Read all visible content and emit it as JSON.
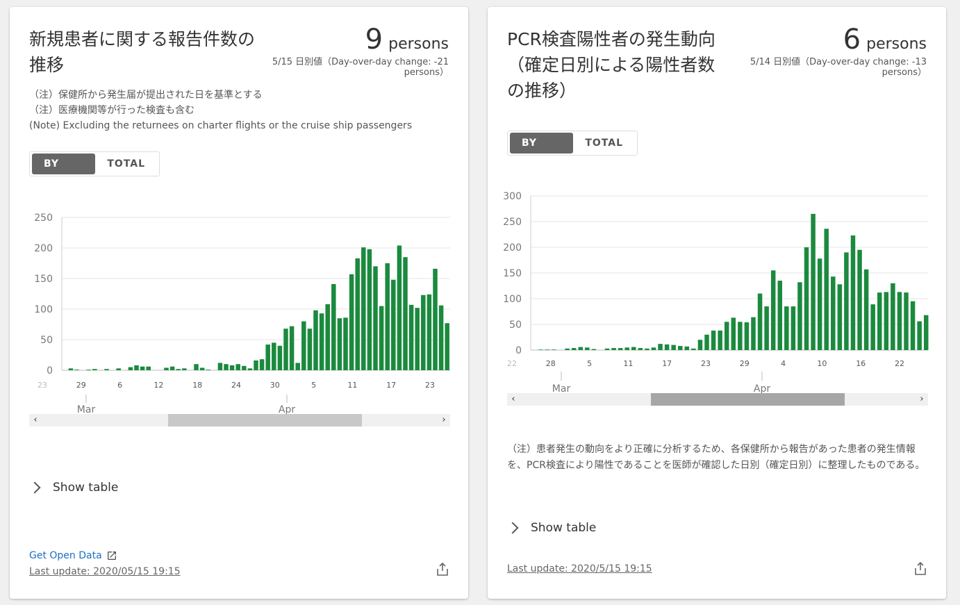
{
  "left_card": {
    "title": "新規患者に関する報告件数の推移",
    "value": "9",
    "unit": "persons",
    "subtext": "5/15 日別値（Day-over-day change: -21 persons）",
    "notes": [
      "（注）保健所から発生届が提出された日を基準とする",
      "（注）医療機関等が行った検査も含む",
      "(Note) Excluding the returnees on charter flights or the cruise ship passengers"
    ],
    "toggle": {
      "by_day": "BY DAY",
      "total": "TOTAL"
    },
    "show_table": "Show table",
    "open_data": "Get Open Data",
    "last_update": "Last update: 2020/05/15 19:15"
  },
  "right_card": {
    "title": "PCR検査陽性者の発生動向（確定日別による陽性者数の推移）",
    "value": "6",
    "unit": "persons",
    "subtext": "5/14 日別値（Day-over-day change: -13 persons）",
    "toggle": {
      "by_day": "BY DAY",
      "total": "TOTAL"
    },
    "description": "（注）患者発生の動向をより正確に分析するため、各保健所から報告があった患者の発生情報を、PCR検査により陽性であることを医師が確認した日別（確定日別）に整理したものである。",
    "show_table": "Show table",
    "last_update": "Last update: 2020/5/15 19:15"
  },
  "colors": {
    "bar": "#1b8a3e",
    "active_toggle": "#666666",
    "link": "#1a6fc4"
  },
  "chart_data": [
    {
      "type": "bar",
      "title": "新規患者に関する報告件数の推移",
      "bar_color": "#1b8a3e",
      "ylim": [
        0,
        250
      ],
      "yticks": [
        0,
        50,
        100,
        150,
        200,
        250
      ],
      "grid": true,
      "x_tick_labels": [
        "23",
        "29",
        "6",
        "12",
        "18",
        "24",
        "30",
        "5",
        "11",
        "17",
        "23"
      ],
      "month_labels": [
        "Mar",
        "Apr"
      ],
      "x": [
        "2/23",
        "2/24",
        "2/25",
        "2/26",
        "2/27",
        "2/28",
        "2/29",
        "3/1",
        "3/2",
        "3/3",
        "3/4",
        "3/5",
        "3/6",
        "3/7",
        "3/8",
        "3/9",
        "3/10",
        "3/11",
        "3/12",
        "3/13",
        "3/14",
        "3/15",
        "3/16",
        "3/17",
        "3/18",
        "3/19",
        "3/20",
        "3/21",
        "3/22",
        "3/23",
        "3/24",
        "3/25",
        "3/26",
        "3/27",
        "3/28",
        "3/29",
        "3/30",
        "3/31",
        "4/1",
        "4/2",
        "4/3",
        "4/4",
        "4/5",
        "4/6",
        "4/7",
        "4/8",
        "4/9",
        "4/10",
        "4/11",
        "4/12",
        "4/13",
        "4/14",
        "4/15",
        "4/16",
        "4/17",
        "4/18",
        "4/19",
        "4/20",
        "4/21",
        "4/22",
        "4/23",
        "4/24",
        "4/25",
        "4/26"
      ],
      "values": [
        0,
        3,
        1,
        0,
        1,
        2,
        0,
        2,
        0,
        3,
        0,
        5,
        8,
        6,
        6,
        0,
        0,
        4,
        6,
        2,
        3,
        0,
        10,
        4,
        1,
        0,
        12,
        10,
        8,
        10,
        7,
        3,
        16,
        18,
        42,
        45,
        40,
        68,
        72,
        12,
        80,
        68,
        98,
        93,
        108,
        141,
        85,
        86,
        157,
        183,
        201,
        198,
        170,
        105,
        175,
        148,
        204,
        185,
        107,
        102,
        123,
        124,
        166,
        106,
        77
      ]
    },
    {
      "type": "bar",
      "title": "PCR検査陽性者の発生動向（確定日別による陽性者数の推移）",
      "bar_color": "#1b8a3e",
      "ylim": [
        0,
        300
      ],
      "yticks": [
        0,
        50,
        100,
        150,
        200,
        250,
        300
      ],
      "grid": true,
      "x_tick_labels": [
        "22",
        "28",
        "5",
        "11",
        "17",
        "23",
        "29",
        "4",
        "10",
        "16",
        "22"
      ],
      "month_labels": [
        "Mar",
        "Apr"
      ],
      "values": [
        0,
        1,
        1,
        1,
        0,
        3,
        4,
        6,
        5,
        2,
        0,
        3,
        4,
        4,
        5,
        6,
        4,
        3,
        5,
        12,
        11,
        10,
        8,
        7,
        3,
        20,
        30,
        38,
        38,
        55,
        63,
        55,
        54,
        64,
        110,
        85,
        155,
        135,
        85,
        85,
        132,
        200,
        265,
        178,
        236,
        143,
        128,
        190,
        223,
        195,
        157,
        89,
        112,
        113,
        130,
        113,
        112,
        95,
        56,
        68
      ]
    }
  ]
}
